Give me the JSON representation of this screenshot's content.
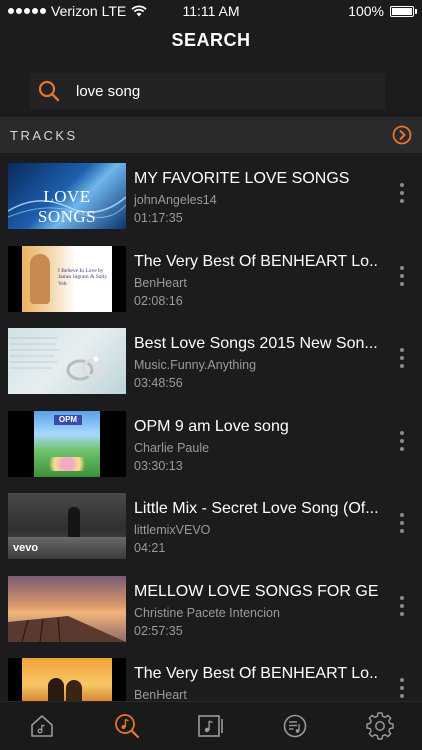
{
  "status_bar": {
    "carrier": "Verizon LTE",
    "time": "11:11 AM",
    "battery": "100%",
    "battery_level": 1.0
  },
  "header": {
    "title": "SEARCH"
  },
  "search": {
    "value": "love song",
    "icon": "search-icon"
  },
  "section": {
    "label": "TRACKS",
    "action_icon": "chevron-right-circle-icon"
  },
  "tracks": [
    {
      "title": "MY FAVORITE LOVE SONGS",
      "channel": "johnAngeles14",
      "duration": "01:17:35",
      "thumb_text": "LOVE SONGS"
    },
    {
      "title": "The Very Best Of BENHEART Lo...",
      "channel": "BenHeart",
      "duration": "02:08:16",
      "thumb_text": "I Believe In Love by James Ingram & Sally Yeh"
    },
    {
      "title": "Best Love Songs 2015 New Son...",
      "channel": "Music.Funny.Anything",
      "duration": "03:48:56"
    },
    {
      "title": "OPM 9 am Love song",
      "channel": "Charlie Paule",
      "duration": "03:30:13",
      "thumb_text": "OPM"
    },
    {
      "title": "Little Mix - Secret Love Song (Of...",
      "channel": "littlemixVEVO",
      "duration": "04:21",
      "thumb_text": "vevo"
    },
    {
      "title": "MELLOW LOVE SONGS FOR GE...",
      "channel": "Christine Pacete Intencion",
      "duration": "02:57:35"
    },
    {
      "title": "The Very Best Of BENHEART Lo...",
      "channel": "BenHeart",
      "duration": ""
    }
  ],
  "tabbar": {
    "items": [
      {
        "icon": "home-icon",
        "active": false
      },
      {
        "icon": "search-music-icon",
        "active": true
      },
      {
        "icon": "music-library-icon",
        "active": false
      },
      {
        "icon": "playlist-icon",
        "active": false
      },
      {
        "icon": "settings-gear-icon",
        "active": false
      }
    ]
  },
  "colors": {
    "accent": "#e8732a",
    "background": "#1c1c1e",
    "secondary_text": "#9a9a9a"
  }
}
